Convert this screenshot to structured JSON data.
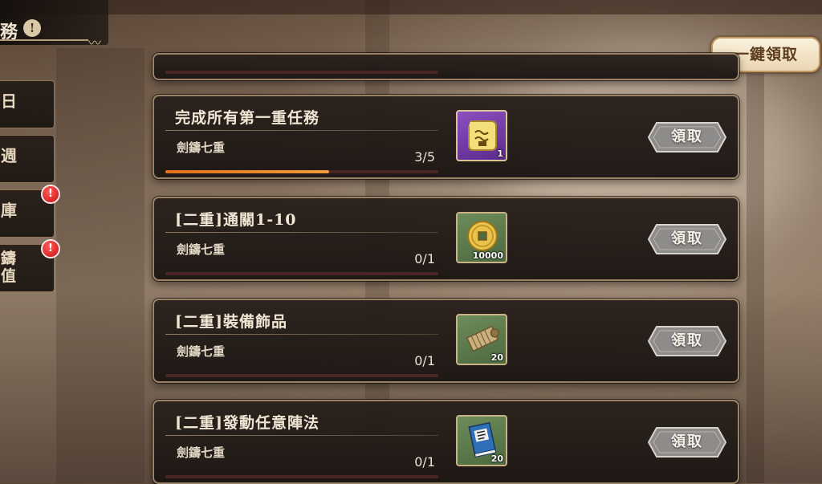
{
  "header": {
    "title": "務",
    "info_glyph": "!"
  },
  "claim_all_label": "一鍵領取",
  "side_tabs": [
    {
      "label": "日"
    },
    {
      "label": "週"
    },
    {
      "label": "庫",
      "alert": "!"
    },
    {
      "label": "鑄\n值",
      "alert": "!"
    }
  ],
  "quests": [
    {
      "title": "完成所有第一重任務",
      "subtitle": "劍鑄七重",
      "progress_text": "3/5",
      "progress": 0.6,
      "reward_icon": "scroll-icon",
      "reward_qty": "1",
      "button": "領取"
    },
    {
      "title": "[二重]通關1-10",
      "subtitle": "劍鑄七重",
      "progress_text": "0/1",
      "progress": 0,
      "reward_icon": "coin-icon",
      "reward_qty": "10000",
      "button": "領取"
    },
    {
      "title": "[二重]裝備飾品",
      "subtitle": "劍鑄七重",
      "progress_text": "0/1",
      "progress": 0,
      "reward_icon": "bamboo-scroll-icon",
      "reward_qty": "20",
      "button": "領取"
    },
    {
      "title": "[二重]發動任意陣法",
      "subtitle": "劍鑄七重",
      "progress_text": "0/1",
      "progress": 0,
      "reward_icon": "book-icon",
      "reward_qty": "20",
      "button": "領取"
    }
  ],
  "colors": {
    "progress_fill": "#e2701c",
    "alert": "#d41818",
    "card_border": "#9b8266"
  }
}
